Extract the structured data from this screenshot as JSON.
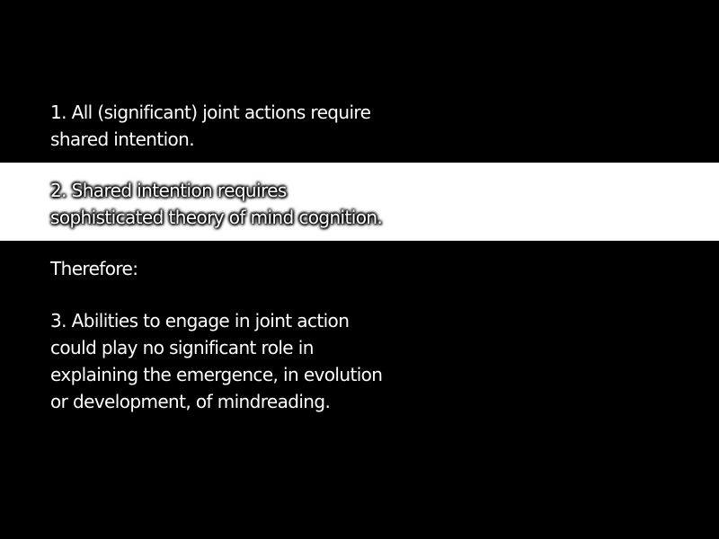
{
  "slide": {
    "point1": [
      "1. All (significant) joint actions require",
      "shared intention."
    ],
    "point2": [
      "2. Shared intention requires",
      "sophisticated theory of mind cognition."
    ],
    "therefore": "Therefore:",
    "point3": [
      "3. Abilities to engage in joint action",
      "could play no significant role in",
      "explaining the emergence, in evolution",
      "or development, of mindreading."
    ]
  },
  "colors": {
    "background": "#000000",
    "highlight_band": "#ffffff",
    "text": "#ffffff"
  }
}
